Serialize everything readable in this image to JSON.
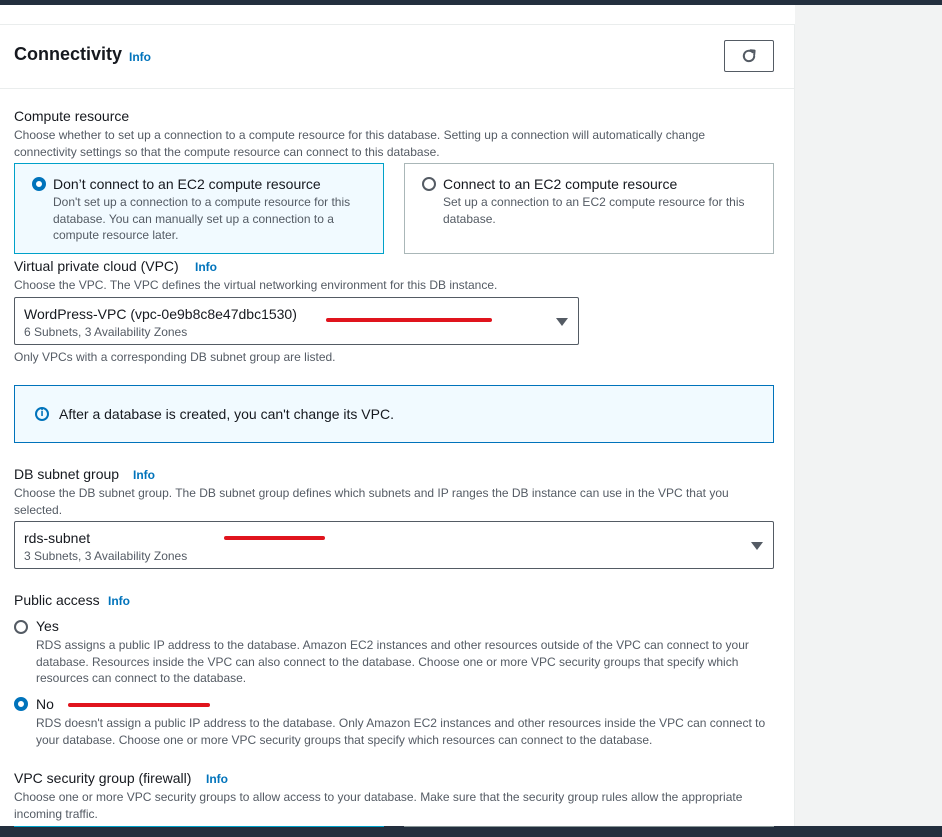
{
  "header": {
    "title": "Connectivity",
    "info": "Info",
    "refresh_icon": "refresh-icon"
  },
  "compute": {
    "label": "Compute resource",
    "description": "Choose whether to set up a connection to a compute resource for this database. Setting up a connection will automatically change connectivity settings so that the compute resource can connect to this database.",
    "options": [
      {
        "title": "Don’t connect to an EC2 compute resource",
        "description": "Don't set up a connection to a compute resource for this database. You can manually set up a connection to a compute resource later.",
        "selected": true
      },
      {
        "title": "Connect to an EC2 compute resource",
        "description": "Set up a connection to an EC2 compute resource for this database.",
        "selected": false
      }
    ]
  },
  "vpc": {
    "label": "Virtual private cloud (VPC)",
    "info": "Info",
    "description": "Choose the VPC. The VPC defines the virtual networking environment for this DB instance.",
    "selected_value": "WordPress-VPC (vpc-0e9b8c8e47dbc1530)",
    "selected_detail": "6 Subnets, 3 Availability Zones",
    "note": "Only VPCs with a corresponding DB subnet group are listed."
  },
  "alert": {
    "text": "After a database is created, you can't change its VPC.",
    "icon": "info-icon"
  },
  "subnet": {
    "label": "DB subnet group",
    "info": "Info",
    "description": "Choose the DB subnet group. The DB subnet group defines which subnets and IP ranges the DB instance can use in the VPC that you selected.",
    "selected_value": "rds-subnet",
    "selected_detail": "3 Subnets, 3 Availability Zones"
  },
  "public_access": {
    "label": "Public access",
    "info": "Info",
    "options": [
      {
        "title": "Yes",
        "description": "RDS assigns a public IP address to the database. Amazon EC2 instances and other resources outside of the VPC can connect to your database. Resources inside the VPC can also connect to the database. Choose one or more VPC security groups that specify which resources can connect to the database.",
        "selected": false
      },
      {
        "title": "No",
        "description": "RDS doesn't assign a public IP address to the database. Only Amazon EC2 instances and other resources inside the VPC can connect to your database. Choose one or more VPC security groups that specify which resources can connect to the database.",
        "selected": true
      }
    ]
  },
  "security_group": {
    "label": "VPC security group (firewall)",
    "info": "Info",
    "description": "Choose one or more VPC security groups to allow access to your database. Make sure that the security group rules allow the appropriate incoming traffic."
  },
  "colors": {
    "accent": "#0073bb",
    "selected_border": "#00a1c9",
    "annotation": "#e0141d"
  }
}
